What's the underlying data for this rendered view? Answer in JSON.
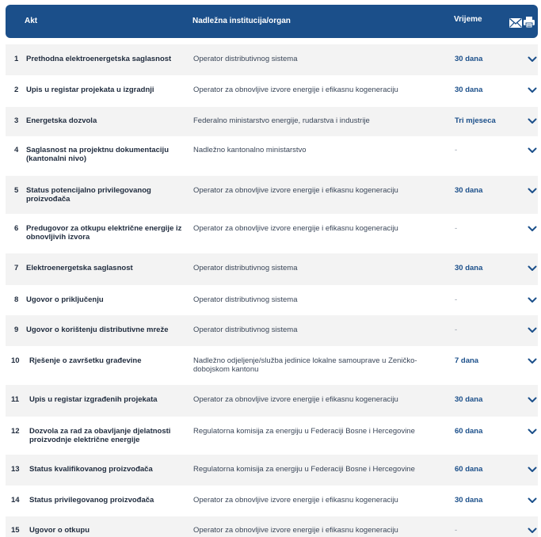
{
  "header": {
    "col_act": "Akt",
    "col_institution": "Nadležna institucija/organ",
    "col_time": "Vrijeme",
    "mail_icon": "mail-icon",
    "print_icon": "print-icon"
  },
  "rows": [
    {
      "num": "1",
      "act": "Prethodna elektroenergetska saglasnost",
      "institution": "Operator distributivnog sistema",
      "time": "30 dana"
    },
    {
      "num": "2",
      "act": "Upis u registar projekata u izgradnji",
      "institution": "Operator za obnovljive izvore energije i efikasnu kogeneraciju",
      "time": "30 dana"
    },
    {
      "num": "3",
      "act": "Energetska dozvola",
      "institution": "Federalno ministarstvo energije, rudarstva i industrije",
      "time": "Tri mjeseca"
    },
    {
      "num": "4",
      "act": "Saglasnost na projektnu dokumentaciju (kantonalni nivo)",
      "institution": "Nadležno kantonalno ministarstvo",
      "time": "-"
    },
    {
      "num": "5",
      "act": "Status potencijalno privilegovanog proizvođača",
      "institution": "Operator za obnovljive izvore energije i efikasnu kogeneraciju",
      "time": "30 dana"
    },
    {
      "num": "6",
      "act": "Predugovor za otkupu električne energije iz obnovljivih izvora",
      "institution": "Operator za obnovljive izvore energije i efikasnu kogeneraciju",
      "time": "-"
    },
    {
      "num": "7",
      "act": "Elektroenergetska saglasnost",
      "institution": "Operator distributivnog sistema",
      "time": "30 dana"
    },
    {
      "num": "8",
      "act": "Ugovor o priključenju",
      "institution": "Operator distributivnog sistema",
      "time": "-"
    },
    {
      "num": "9",
      "act": "Ugovor o korištenju distributivne mreže",
      "institution": "Operator distributivnog sistema",
      "time": "-"
    },
    {
      "num": "10",
      "act": "Rješenje o završetku građevine",
      "institution": "Nadležno odjeljenje/služba jedinice lokalne samouprave u Zeničko-dobojskom kantonu",
      "time": "7 dana"
    },
    {
      "num": "11",
      "act": "Upis u registar izgrađenih projekata",
      "institution": "Operator za obnovljive izvore energije i efikasnu kogeneraciju",
      "time": "30 dana"
    },
    {
      "num": "12",
      "act": "Dozvola za rad za obavljanje djelatnosti proizvodnje električne energije",
      "institution": "Regulatorna komisija za energiju u Federaciji Bosne i Hercegovine",
      "time": "60 dana"
    },
    {
      "num": "13",
      "act": "Status kvalifikovanog proizvođača",
      "institution": "Regulatorna komisija za energiju u Federaciji Bosne i Hercegovine",
      "time": "60 dana"
    },
    {
      "num": "14",
      "act": "Status privilegovanog proizvođača",
      "institution": "Operator za obnovljive izvore energije i efikasnu kogeneraciju",
      "time": "30 dana"
    },
    {
      "num": "15",
      "act": "Ugovor o otkupu",
      "institution": "Operator za obnovljive izvore energije i efikasnu kogeneraciju",
      "time": "-"
    }
  ],
  "colors": {
    "header_bg": "#1b4f8a",
    "accent": "#1b4f8a",
    "stripe": "#f3f3f3"
  }
}
